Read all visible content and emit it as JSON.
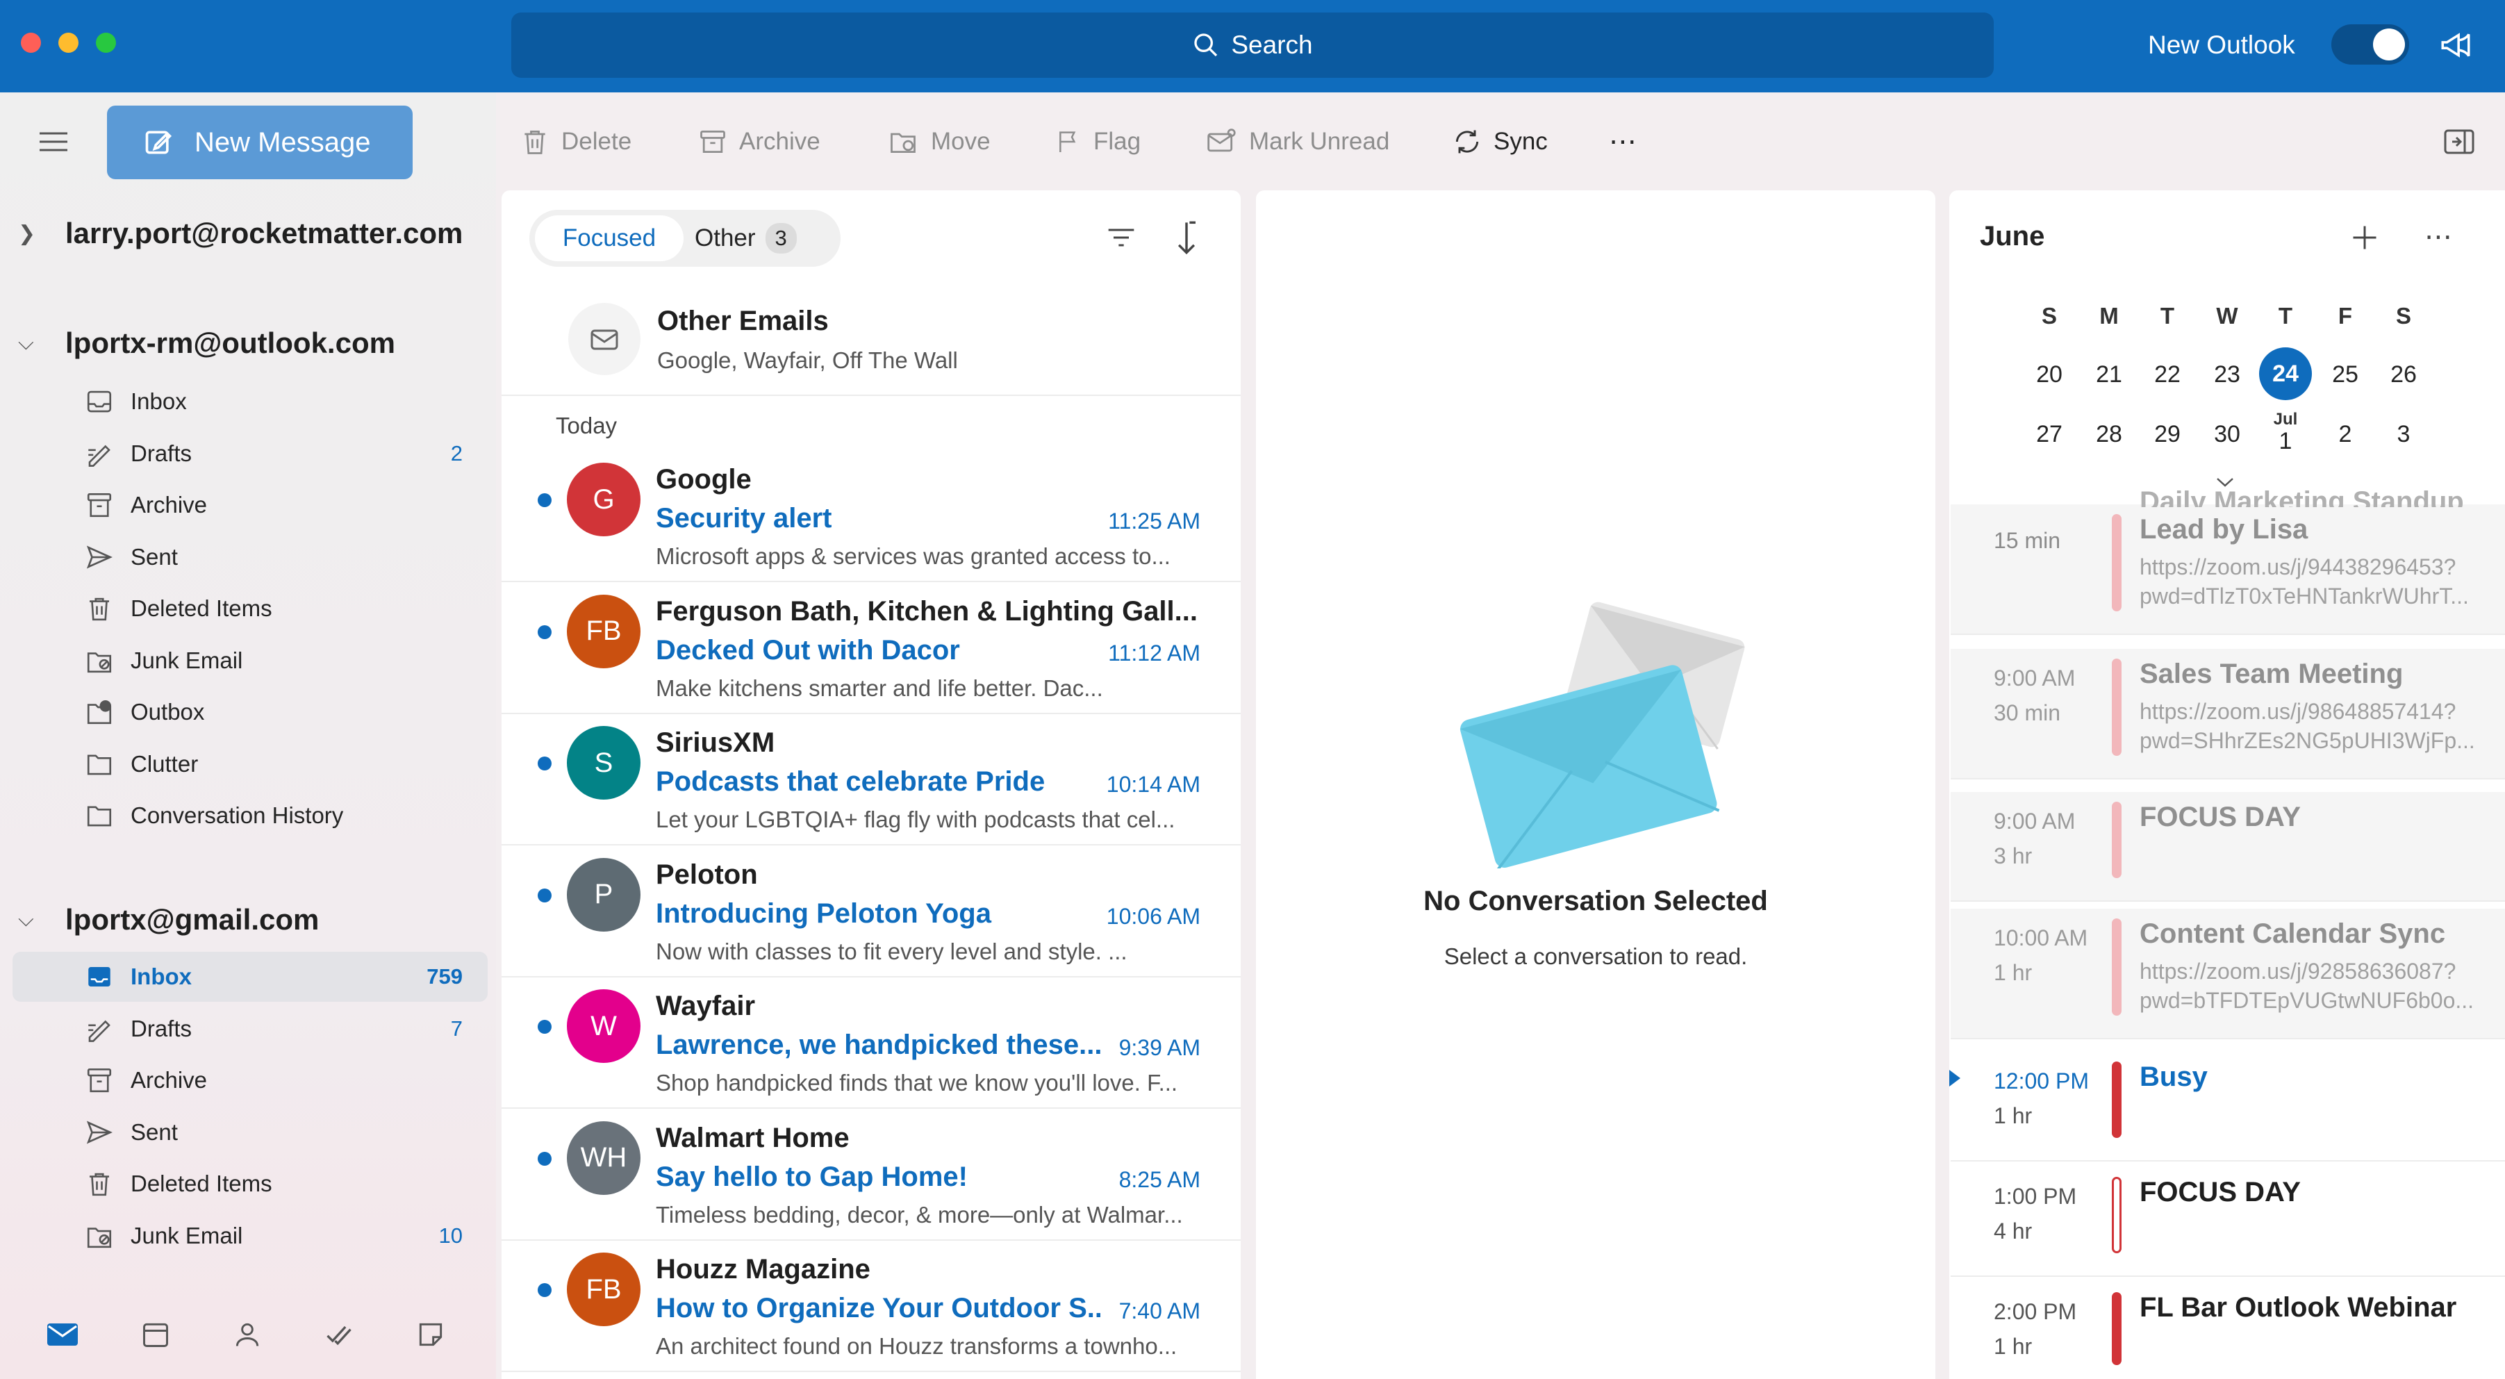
{
  "titlebar": {
    "search_label": "Search",
    "new_outlook_label": "New Outlook",
    "toggle_on": true
  },
  "nav": {
    "new_message_label": "New Message",
    "accounts": [
      {
        "email": "larry.port@rocketmatter.com",
        "expanded": false,
        "folders": []
      },
      {
        "email": "lportx-rm@outlook.com",
        "expanded": true,
        "folders": [
          {
            "label": "Inbox",
            "count": "",
            "icon": "inbox-icon"
          },
          {
            "label": "Drafts",
            "count": "2",
            "icon": "drafts-icon"
          },
          {
            "label": "Archive",
            "count": "",
            "icon": "archive-icon"
          },
          {
            "label": "Sent",
            "count": "",
            "icon": "sent-icon"
          },
          {
            "label": "Deleted Items",
            "count": "",
            "icon": "trash-icon"
          },
          {
            "label": "Junk Email",
            "count": "",
            "icon": "junk-icon"
          },
          {
            "label": "Outbox",
            "count": "",
            "icon": "outbox-icon"
          },
          {
            "label": "Clutter",
            "count": "",
            "icon": "folder-icon"
          },
          {
            "label": "Conversation History",
            "count": "",
            "icon": "folder-icon"
          }
        ]
      },
      {
        "email": "lportx@gmail.com",
        "expanded": true,
        "folders": [
          {
            "label": "Inbox",
            "count": "759",
            "icon": "inbox-icon",
            "selected": true
          },
          {
            "label": "Drafts",
            "count": "7",
            "icon": "drafts-icon"
          },
          {
            "label": "Archive",
            "count": "",
            "icon": "archive-icon"
          },
          {
            "label": "Sent",
            "count": "",
            "icon": "sent-icon"
          },
          {
            "label": "Deleted Items",
            "count": "",
            "icon": "trash-icon"
          },
          {
            "label": "Junk Email",
            "count": "10",
            "icon": "junk-icon"
          }
        ]
      }
    ],
    "bottom_icons": [
      "mail-icon",
      "calendar-icon",
      "people-icon",
      "tasks-icon",
      "notes-icon"
    ]
  },
  "toolbar": {
    "delete": "Delete",
    "archive": "Archive",
    "move": "Move",
    "flag": "Flag",
    "mark_unread": "Mark Unread",
    "sync": "Sync"
  },
  "list": {
    "tab_focused": "Focused",
    "tab_other": "Other",
    "other_count": "3",
    "other_emails_title": "Other Emails",
    "other_emails_senders": "Google, Wayfair, Off The Wall",
    "group_today": "Today",
    "messages": [
      {
        "initials": "G",
        "color": "#d13438",
        "sender": "Google",
        "subject": "Security alert",
        "time": "11:25 AM",
        "preview": "Microsoft apps & services was granted access to..."
      },
      {
        "initials": "FB",
        "color": "#ca5010",
        "sender": "Ferguson Bath, Kitchen & Lighting Gall...",
        "subject": "Decked Out with Dacor",
        "time": "11:12 AM",
        "preview": "Make kitchens smarter and life better.          Dac..."
      },
      {
        "initials": "S",
        "color": "#038387",
        "sender": "SiriusXM",
        "subject": "Podcasts that celebrate Pride",
        "time": "10:14 AM",
        "preview": "Let your LGBTQIA+ flag fly with podcasts that cel..."
      },
      {
        "initials": "P",
        "color": "#5e6b73",
        "sender": "Peloton",
        "subject": "Introducing Peloton Yoga",
        "time": "10:06 AM",
        "preview": "Now with classes to fit every level and style.        ..."
      },
      {
        "initials": "W",
        "color": "#e3008c",
        "sender": "Wayfair",
        "subject": "Lawrence, we handpicked these...",
        "time": "9:39 AM",
        "preview": "Shop handpicked finds that we know you'll love. F..."
      },
      {
        "initials": "WH",
        "color": "#69727a",
        "sender": "Walmart Home",
        "subject": "Say hello to Gap Home!",
        "time": "8:25 AM",
        "preview": "Timeless bedding, decor, & more—only at Walmar..."
      },
      {
        "initials": "FB",
        "color": "#ca5010",
        "sender": "Houzz Magazine",
        "subject": "How to Organize Your Outdoor S...",
        "time": "7:40 AM",
        "preview": "An architect found on Houzz transforms a townho..."
      }
    ]
  },
  "reading": {
    "empty_title": "No Conversation Selected",
    "empty_subtitle": "Select a conversation to read."
  },
  "calendar": {
    "month": "June",
    "weekday_headers": [
      "S",
      "M",
      "T",
      "W",
      "T",
      "F",
      "S"
    ],
    "week1": [
      "20",
      "21",
      "22",
      "23",
      "24",
      "25",
      "26"
    ],
    "week2": [
      "27",
      "28",
      "29",
      "30",
      "1",
      "2",
      "3"
    ],
    "jul_label": "Jul",
    "today": "24",
    "events": [
      {
        "time": "",
        "duration": "15 min",
        "title": "Lead by Lisa",
        "title_partial": "Daily Marketing Standup",
        "sub1": "https://zoom.us/j/94438296453?",
        "sub2": "pwd=dTlzT0xTeHNTankrWUhrT...",
        "past": true,
        "bar": "#f2b7bb"
      },
      {
        "time": "9:00 AM",
        "duration": "30 min",
        "title": "Sales Team Meeting",
        "sub1": "https://zoom.us/j/98648857414?",
        "sub2": "pwd=SHhrZEs2NG5pUHI3WjFp...",
        "past": true,
        "bar": "#f2b7bb"
      },
      {
        "time": "9:00 AM",
        "duration": "3 hr",
        "title": "FOCUS DAY",
        "sub1": "",
        "sub2": "",
        "past": true,
        "bar": "#f2b7bb"
      },
      {
        "time": "10:00 AM",
        "duration": "1 hr",
        "title": "Content Calendar Sync",
        "sub1": "https://zoom.us/j/92858636087?",
        "sub2": "pwd=bTFDTEpVUGtwNUF6b0o...",
        "past": true,
        "bar": "#f2b7bb"
      },
      {
        "time": "12:00 PM",
        "duration": "1 hr",
        "title": "Busy",
        "sub1": "",
        "sub2": "",
        "past": false,
        "current": true,
        "bar": "#d13438"
      },
      {
        "time": "1:00 PM",
        "duration": "4 hr",
        "title": "FOCUS DAY",
        "sub1": "",
        "sub2": "",
        "past": false,
        "outline": true,
        "bar": "#d13438"
      },
      {
        "time": "2:00 PM",
        "duration": "1 hr",
        "title": "FL Bar Outlook Webinar",
        "sub1": "",
        "sub2": "",
        "past": false,
        "bar": "#d13438"
      }
    ]
  },
  "colors": {
    "accent": "#0f6cbd",
    "titlebar": "#0f6cbd",
    "new_message_button": "#5b9ad6"
  }
}
